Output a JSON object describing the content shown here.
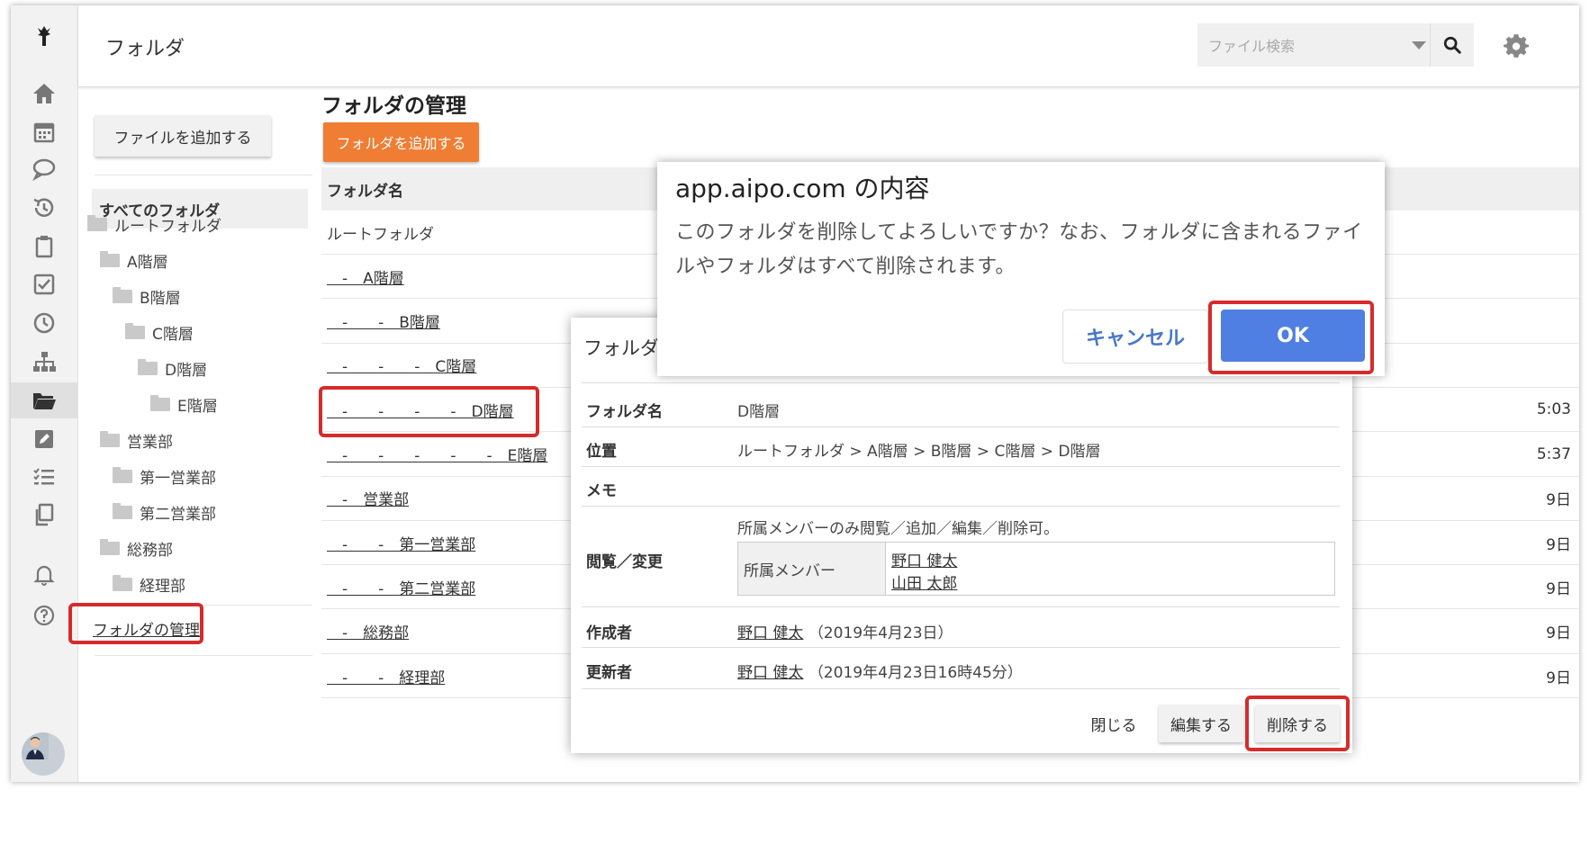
{
  "header": {
    "title": "フォルダ",
    "search_placeholder": "ファイル検索"
  },
  "rail_icons": [
    "logo-icon",
    "home-icon",
    "calendar-icon",
    "chat-icon",
    "history-icon",
    "clipboard-icon",
    "checkbox-icon",
    "clock-icon",
    "org-chart-icon",
    "folder-open-icon",
    "edit-icon",
    "list-icon",
    "copy-icon",
    "bell-icon",
    "help-icon"
  ],
  "sidebar": {
    "add_file_label": "ファイルを追加する",
    "all_folders_label": "すべてのフォルダ",
    "tree": [
      {
        "label": "ルートフォルダ",
        "depth": 0
      },
      {
        "label": "A階層",
        "depth": 1
      },
      {
        "label": "B階層",
        "depth": 2
      },
      {
        "label": "C階層",
        "depth": 3
      },
      {
        "label": "D階層",
        "depth": 4
      },
      {
        "label": "E階層",
        "depth": 5
      },
      {
        "label": "営業部",
        "depth": 1
      },
      {
        "label": "第一営業部",
        "depth": 2
      },
      {
        "label": "第二営業部",
        "depth": 2
      },
      {
        "label": "総務部",
        "depth": 1
      },
      {
        "label": "経理部",
        "depth": 2
      }
    ],
    "manage_label": "フォルダの管理"
  },
  "main": {
    "title": "フォルダの管理",
    "add_folder_label": "フォルダを追加する",
    "column_folder_name": "フォルダ名",
    "rows": [
      {
        "name": "ルートフォルダ",
        "link": false,
        "date": ""
      },
      {
        "name": "　-　A階層",
        "link": true,
        "date": ""
      },
      {
        "name": "　-　　-　B階層",
        "link": true,
        "date": ""
      },
      {
        "name": "　-　　-　　-　C階層",
        "link": true,
        "date": ""
      },
      {
        "name": "　-　　-　　-　　-　D階層",
        "link": true,
        "date": "5:03"
      },
      {
        "name": "　-　　-　　-　　-　　-　E階層",
        "link": true,
        "date": "5:37"
      },
      {
        "name": "　-　営業部",
        "link": true,
        "date": "9日"
      },
      {
        "name": "　-　　-　第一営業部",
        "link": true,
        "date": "9日"
      },
      {
        "name": "　-　　-　第二営業部",
        "link": true,
        "date": "9日"
      },
      {
        "name": "　-　総務部",
        "link": true,
        "date": "9日"
      },
      {
        "name": "　-　　-　経理部",
        "link": true,
        "date": "9日"
      }
    ]
  },
  "detail_modal": {
    "title": "フォルダ",
    "label_name": "フォルダ名",
    "value_name": "D階層",
    "label_location": "位置",
    "value_location": "ルートフォルダ > A階層 > B階層 > C階層 > D階層",
    "label_memo": "メモ",
    "label_access": "閲覧／変更",
    "access_note": "所属メンバーのみ閲覧／追加／編集／削除可。",
    "members_label": "所属メンバー",
    "members": [
      "野口 健太",
      "山田 太郎"
    ],
    "label_creator": "作成者",
    "creator_name": "野口 健太",
    "creator_date": "（2019年4月23日）",
    "label_updater": "更新者",
    "updater_name": "野口 健太",
    "updater_date": "（2019年4月23日16時45分）",
    "close_label": "閉じる",
    "edit_label": "編集する",
    "delete_label": "削除する"
  },
  "confirm_dialog": {
    "title": "app.aipo.com の内容",
    "message": "このフォルダを削除してよろしいですか？なお、フォルダに含まれるファイルやフォルダはすべて削除されます。",
    "cancel_label": "キャンセル",
    "ok_label": "OK"
  },
  "colors": {
    "accent_orange": "#ef7d33",
    "ok_blue": "#4f7fe2",
    "highlight_red": "#d52b2b"
  }
}
